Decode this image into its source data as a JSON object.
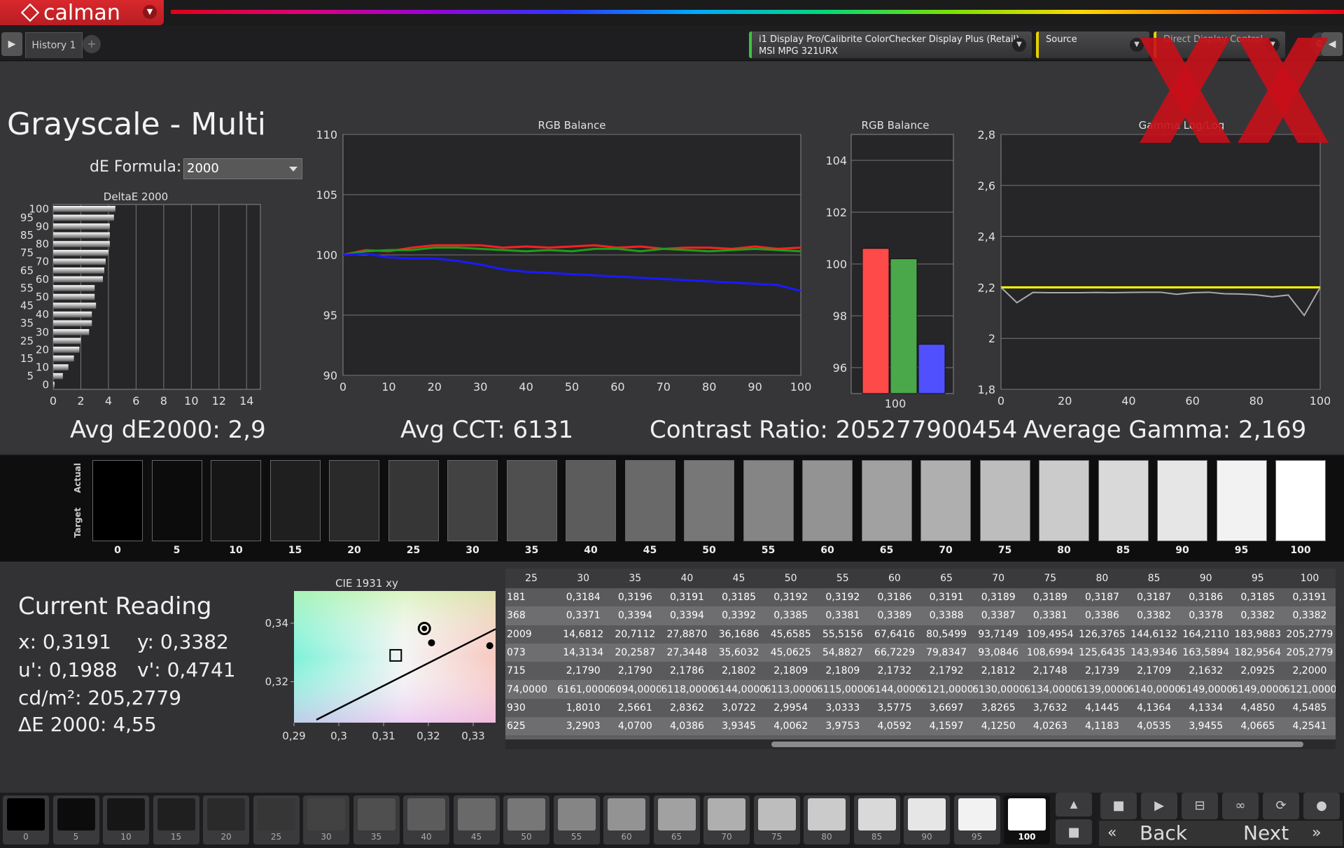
{
  "app": {
    "logo_text": "calman",
    "history_tab": "History 1",
    "add_tab": "+"
  },
  "toolbar": {
    "meter_line1": "i1 Display Pro/Calibrite ColorChecker Display Plus (Retail)",
    "meter_line2": "MSI MPG 321URX",
    "source_label": "Source",
    "display_control_label": "Direct Display Control"
  },
  "page": {
    "title": "Grayscale - Multi",
    "de_formula_label": "dE Formula:",
    "de_formula_value": "2000"
  },
  "stats": {
    "avg_de": "Avg dE2000: 2,9",
    "avg_cct": "Avg CCT: 6131",
    "contrast": "Contrast Ratio: 205277900454",
    "avg_gamma": "Average Gamma: 2,169"
  },
  "swatches": {
    "actual_label": "Actual",
    "target_label": "Target",
    "levels": [
      "0",
      "5",
      "10",
      "15",
      "20",
      "25",
      "30",
      "35",
      "40",
      "45",
      "50",
      "55",
      "60",
      "65",
      "70",
      "75",
      "80",
      "85",
      "90",
      "95",
      "100"
    ],
    "grays": [
      "#000000",
      "#0c0c0c",
      "#161616",
      "#1f1f1f",
      "#2a2a2a",
      "#363636",
      "#424242",
      "#4f4f4f",
      "#5c5c5c",
      "#696969",
      "#777777",
      "#858585",
      "#939393",
      "#a1a1a1",
      "#afafaf",
      "#bdbdbd",
      "#cbcbcb",
      "#d9d9d9",
      "#e6e6e6",
      "#f2f2f2",
      "#ffffff"
    ]
  },
  "current_reading": {
    "title": "Current Reading",
    "x": "x: 0,3191",
    "y": "y: 0,3382",
    "u": "u': 0,1988",
    "v": "v': 0,4741",
    "lum": "cd/m²: 205,2779",
    "de": "ΔE 2000: 4,55"
  },
  "table": {
    "headers": [
      "25",
      "30",
      "35",
      "40",
      "45",
      "50",
      "55",
      "60",
      "65",
      "70",
      "75",
      "80",
      "85",
      "90",
      "95",
      "100"
    ],
    "rows": [
      [
        "181",
        "0,3184",
        "0,3196",
        "0,3191",
        "0,3185",
        "0,3192",
        "0,3192",
        "0,3186",
        "0,3191",
        "0,3189",
        "0,3189",
        "0,3187",
        "0,3187",
        "0,3186",
        "0,3185",
        "0,3191"
      ],
      [
        "368",
        "0,3371",
        "0,3394",
        "0,3394",
        "0,3392",
        "0,3385",
        "0,3381",
        "0,3389",
        "0,3388",
        "0,3387",
        "0,3381",
        "0,3386",
        "0,3382",
        "0,3378",
        "0,3382",
        "0,3382"
      ],
      [
        "2009",
        "14,6812",
        "20,7112",
        "27,8870",
        "36,1686",
        "45,6585",
        "55,5156",
        "67,6416",
        "80,5499",
        "93,7149",
        "109,4954",
        "126,3765",
        "144,6132",
        "164,2110",
        "183,9883",
        "205,2779"
      ],
      [
        "073",
        "14,3134",
        "20,2587",
        "27,3448",
        "35,6032",
        "45,0625",
        "54,8827",
        "66,7229",
        "79,8347",
        "93,0846",
        "108,6994",
        "125,6435",
        "143,9346",
        "163,5894",
        "182,9564",
        "205,2779"
      ],
      [
        "715",
        "2,1790",
        "2,1790",
        "2,1786",
        "2,1802",
        "2,1809",
        "2,1809",
        "2,1732",
        "2,1792",
        "2,1812",
        "2,1748",
        "2,1739",
        "2,1709",
        "2,1632",
        "2,0925",
        "2,2000"
      ],
      [
        "74,0000",
        "6161,0000",
        "6094,0000",
        "6118,0000",
        "6144,0000",
        "6113,0000",
        "6115,0000",
        "6144,0000",
        "6121,0000",
        "6130,0000",
        "6134,0000",
        "6139,0000",
        "6140,0000",
        "6149,0000",
        "6149,0000",
        "6121,0000"
      ],
      [
        "930",
        "1,8010",
        "2,5661",
        "2,8362",
        "3,0722",
        "2,9954",
        "3,0333",
        "3,5775",
        "3,6697",
        "3,8265",
        "3,7632",
        "4,1445",
        "4,1364",
        "4,1334",
        "4,4850",
        "4,5485"
      ],
      [
        "625",
        "3,2903",
        "4,0700",
        "4,0386",
        "3,9345",
        "4,0062",
        "3,9753",
        "4,0592",
        "4,1597",
        "4,1250",
        "4,0263",
        "4,1183",
        "4,0535",
        "3,9455",
        "4,0665",
        "4,2541"
      ]
    ]
  },
  "bottom": {
    "levels": [
      "0",
      "5",
      "10",
      "15",
      "20",
      "25",
      "30",
      "35",
      "40",
      "45",
      "50",
      "55",
      "60",
      "65",
      "70",
      "75",
      "80",
      "85",
      "90",
      "95",
      "100"
    ],
    "back_label": "Back",
    "next_label": "Next"
  },
  "chart_data": [
    {
      "type": "bar",
      "title": "DeltaE 2000",
      "orientation": "horizontal",
      "categories": [
        "100",
        "95",
        "90",
        "85",
        "80",
        "75",
        "70",
        "65",
        "60",
        "55",
        "50",
        "45",
        "40",
        "35",
        "30",
        "25",
        "20",
        "15",
        "10",
        "5",
        "0"
      ],
      "values": [
        4.5,
        4.4,
        4.1,
        4.1,
        4.1,
        4.0,
        3.8,
        3.7,
        3.6,
        3.0,
        3.0,
        3.1,
        2.8,
        2.8,
        2.6,
        2.0,
        1.9,
        1.5,
        1.1,
        0.7,
        0.1
      ],
      "xlim": [
        0,
        15
      ],
      "xticks": [
        "0",
        "2",
        "4",
        "6",
        "8",
        "10",
        "12",
        "14"
      ],
      "yticks": [
        "100",
        "95",
        "90",
        "85",
        "80",
        "75",
        "70",
        "65",
        "60",
        "55",
        "50",
        "45",
        "40",
        "35",
        "30",
        "25",
        "20",
        "15",
        "10",
        "5",
        "0"
      ]
    },
    {
      "type": "line",
      "title": "RGB Balance",
      "x": [
        0,
        5,
        10,
        15,
        20,
        25,
        30,
        35,
        40,
        45,
        50,
        55,
        60,
        65,
        70,
        75,
        80,
        85,
        90,
        95,
        100
      ],
      "series": [
        {
          "name": "Red",
          "color": "#ff2020",
          "values": [
            100.0,
            100.4,
            100.3,
            100.6,
            100.8,
            100.8,
            100.8,
            100.6,
            100.7,
            100.6,
            100.7,
            100.8,
            100.6,
            100.7,
            100.5,
            100.6,
            100.6,
            100.5,
            100.7,
            100.5,
            100.6
          ]
        },
        {
          "name": "Green",
          "color": "#1aa01a",
          "values": [
            100.0,
            100.3,
            100.4,
            100.4,
            100.6,
            100.6,
            100.5,
            100.4,
            100.3,
            100.4,
            100.3,
            100.5,
            100.5,
            100.3,
            100.5,
            100.4,
            100.3,
            100.4,
            100.5,
            100.4,
            100.3
          ]
        },
        {
          "name": "Blue",
          "color": "#1a1aff",
          "values": [
            100.0,
            100.1,
            99.8,
            99.7,
            99.7,
            99.5,
            99.2,
            98.8,
            98.6,
            98.5,
            98.4,
            98.3,
            98.2,
            98.1,
            98.0,
            97.9,
            97.8,
            97.7,
            97.6,
            97.5,
            97.0
          ]
        }
      ],
      "xlim": [
        0,
        100
      ],
      "ylim": [
        90,
        110
      ],
      "xticks": [
        "0",
        "10",
        "20",
        "30",
        "40",
        "50",
        "60",
        "70",
        "80",
        "90",
        "100"
      ],
      "yticks": [
        "90",
        "95",
        "100",
        "105",
        "110"
      ]
    },
    {
      "type": "bar",
      "title": "RGB Balance",
      "categories": [
        "100"
      ],
      "series": [
        {
          "name": "Red",
          "color": "#ff4a4a",
          "values": [
            100.6
          ]
        },
        {
          "name": "Green",
          "color": "#4aa84a",
          "values": [
            100.2
          ]
        },
        {
          "name": "Blue",
          "color": "#5050ff",
          "values": [
            96.9
          ]
        }
      ],
      "ylim": [
        95,
        105
      ],
      "yticks": [
        "96",
        "98",
        "100",
        "102",
        "104"
      ]
    },
    {
      "type": "line",
      "title": "Gamma Log/Log",
      "x": [
        0,
        5,
        10,
        15,
        20,
        25,
        30,
        35,
        40,
        45,
        50,
        55,
        60,
        65,
        70,
        75,
        80,
        85,
        90,
        95,
        100
      ],
      "series": [
        {
          "name": "Target",
          "color": "#ffff00",
          "values": [
            2.2,
            2.2,
            2.2,
            2.2,
            2.2,
            2.2,
            2.2,
            2.2,
            2.2,
            2.2,
            2.2,
            2.2,
            2.2,
            2.2,
            2.2,
            2.2,
            2.2,
            2.2,
            2.2,
            2.2,
            2.2
          ]
        },
        {
          "name": "Measured",
          "color": "#aaaaaa",
          "values": [
            2.2,
            2.14,
            2.18,
            2.179,
            2.179,
            2.179,
            2.18,
            2.179,
            2.18,
            2.181,
            2.181,
            2.173,
            2.179,
            2.181,
            2.175,
            2.174,
            2.171,
            2.163,
            2.17,
            2.09,
            2.2
          ]
        }
      ],
      "xlim": [
        0,
        100
      ],
      "ylim": [
        1.8,
        2.8
      ],
      "xticks": [
        "0",
        "20",
        "40",
        "60",
        "80",
        "100"
      ],
      "yticks": [
        "1,8",
        "2",
        "2,2",
        "2,4",
        "2,6",
        "2,8"
      ]
    },
    {
      "type": "scatter",
      "title": "CIE 1931 xy",
      "xlim": [
        0.29,
        0.335
      ],
      "ylim": [
        0.306,
        0.351
      ],
      "xticks": [
        "0,29",
        "0,3",
        "0,31",
        "0,32",
        "0,33"
      ],
      "yticks": [
        "0,32",
        "0,34"
      ],
      "points": [
        {
          "name": "target",
          "x": 0.3127,
          "y": 0.329
        },
        {
          "name": "current",
          "x": 0.3191,
          "y": 0.3382
        },
        {
          "name": "a",
          "x": 0.3207,
          "y": 0.3333
        },
        {
          "name": "b",
          "x": 0.3337,
          "y": 0.3323
        }
      ],
      "planckian_line": [
        [
          0.295,
          0.307
        ],
        [
          0.335,
          0.338
        ]
      ]
    }
  ]
}
